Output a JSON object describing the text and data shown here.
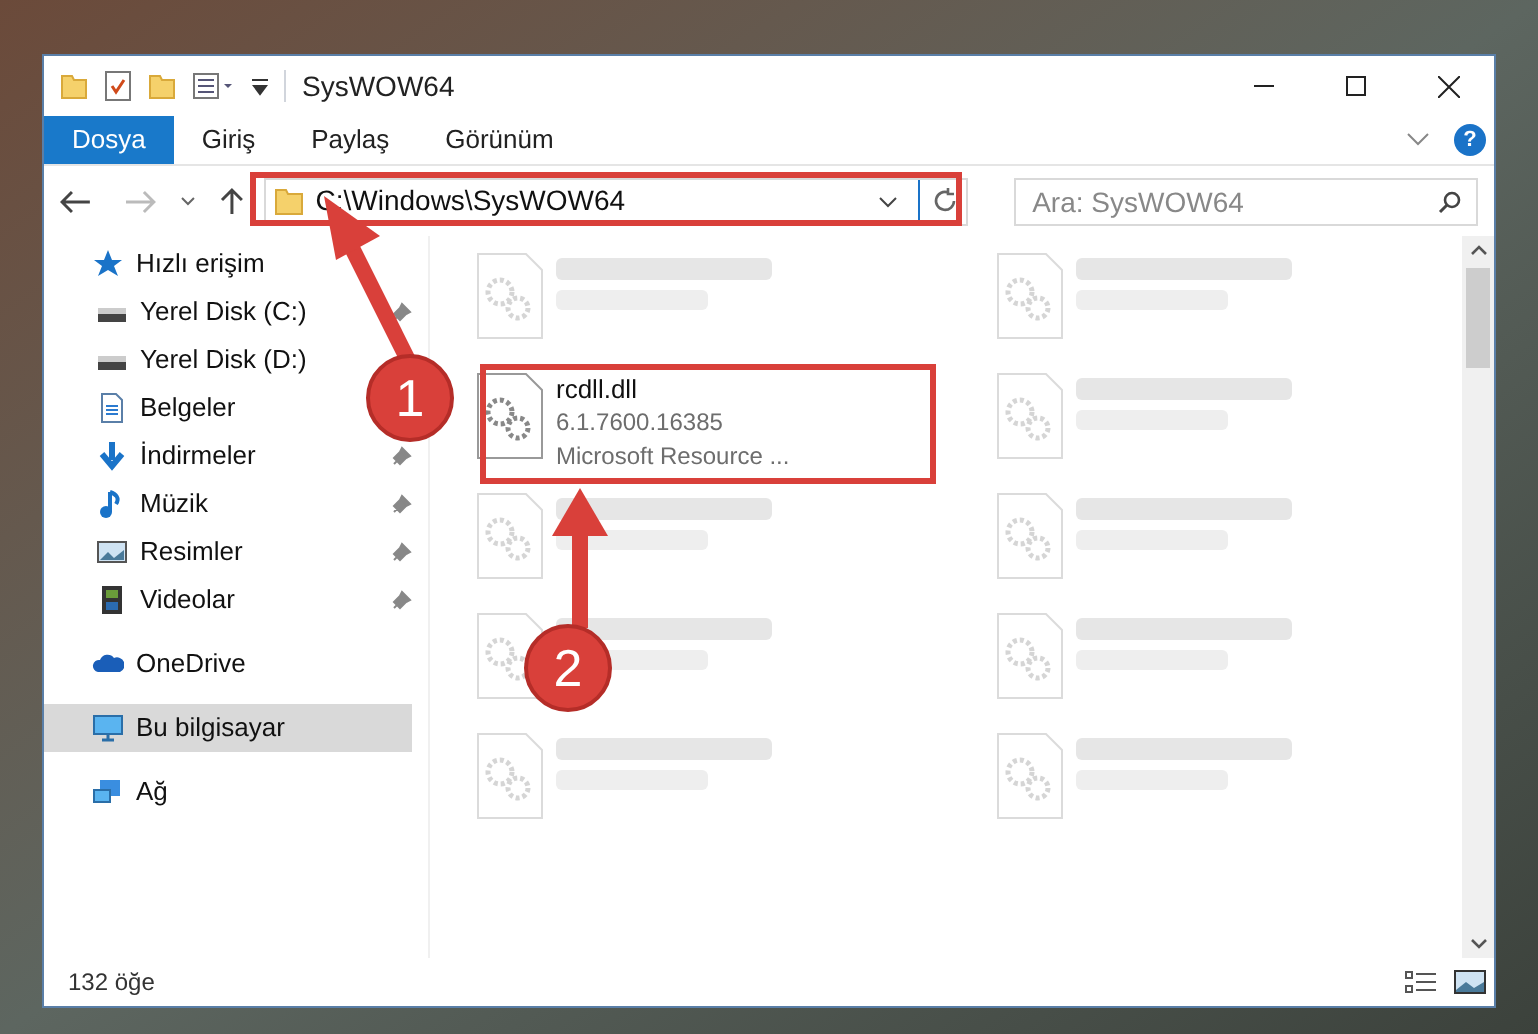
{
  "window": {
    "title": "SysWOW64"
  },
  "ribbon_tabs": [
    {
      "label": "Dosya",
      "selected": true
    },
    {
      "label": "Giriş",
      "selected": false
    },
    {
      "label": "Paylaş",
      "selected": false
    },
    {
      "label": "Görünüm",
      "selected": false
    }
  ],
  "address_bar": {
    "path": "C:\\Windows\\SysWOW64"
  },
  "search": {
    "placeholder": "Ara: SysWOW64"
  },
  "nav_pane": {
    "items": [
      {
        "label": "Hızlı erişim",
        "kind": "star",
        "pinned": false,
        "selected": false
      },
      {
        "label": "Yerel Disk (C:)",
        "kind": "drive",
        "pinned": true,
        "selected": false
      },
      {
        "label": "Yerel Disk (D:)",
        "kind": "drive",
        "pinned": false,
        "selected": false
      },
      {
        "label": "Belgeler",
        "kind": "docs",
        "pinned": false,
        "selected": false
      },
      {
        "label": "İndirmeler",
        "kind": "download",
        "pinned": true,
        "selected": false
      },
      {
        "label": "Müzik",
        "kind": "music",
        "pinned": true,
        "selected": false
      },
      {
        "label": "Resimler",
        "kind": "pictures",
        "pinned": true,
        "selected": false
      },
      {
        "label": "Videolar",
        "kind": "videos",
        "pinned": true,
        "selected": false
      },
      {
        "label": "OneDrive",
        "kind": "cloud",
        "pinned": false,
        "selected": false
      },
      {
        "label": "Bu bilgisayar",
        "kind": "computer",
        "pinned": false,
        "selected": true
      },
      {
        "label": "Ağ",
        "kind": "network",
        "pinned": false,
        "selected": false
      }
    ]
  },
  "files": {
    "columns": [
      [
        {
          "blurred": true
        },
        {
          "name": "rcdll.dll",
          "lines": [
            "6.1.7600.16385",
            "Microsoft Resource ..."
          ],
          "blurred": false
        },
        {
          "blurred": true
        },
        {
          "blurred": true
        },
        {
          "blurred": true
        }
      ],
      [
        {
          "blurred": true
        },
        {
          "blurred": true
        },
        {
          "blurred": true
        },
        {
          "blurred": true
        },
        {
          "blurred": true
        }
      ]
    ]
  },
  "help_button": {
    "glyph": "?"
  },
  "status_bar": {
    "item_count": "132 öğe"
  },
  "callouts": [
    {
      "number": "1"
    },
    {
      "number": "2"
    }
  ]
}
